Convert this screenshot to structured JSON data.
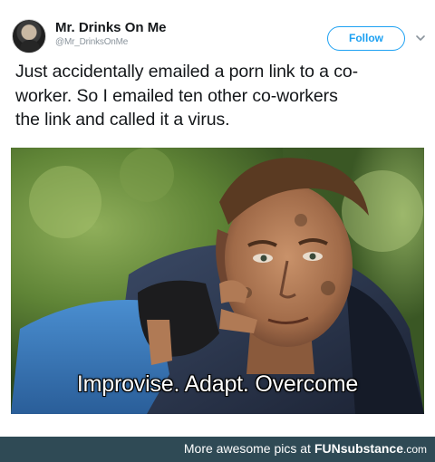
{
  "tweet": {
    "display_name": "Mr. Drinks On Me",
    "handle": "@Mr_DrinksOnMe",
    "follow_label": "Follow",
    "text_lines": [
      "Just accidentally emailed a porn link to a co-",
      "worker. So I emailed ten other co-workers",
      "the link and called it a virus."
    ],
    "accent_color": "#1da1f2"
  },
  "meme": {
    "caption": "Improvise. Adapt. Overcome"
  },
  "footer": {
    "prefix": "More awesome pics at",
    "brand_fun": "FUN",
    "brand_sub": "substance",
    "brand_dom": ".com",
    "background": "#2f4a55"
  }
}
